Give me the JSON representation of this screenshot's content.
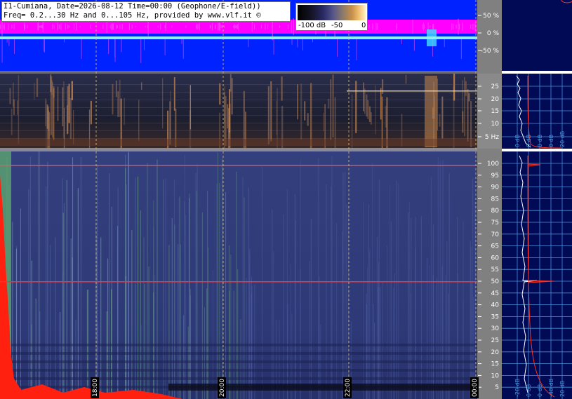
{
  "window": {
    "title_line1": "I1-Cumiana, Date=2026-08-12 Time=00:00 (Geophone/E-field))",
    "title_line2": "Freq= 0.2...30 Hz and 0...105 Hz, provided by www.vlf.it ©"
  },
  "colors": {
    "background": "#ffffff",
    "top_panel_bg": "#0022ff",
    "top_trace": "#ff00ff",
    "side_panel_bg": "#000a55",
    "spectrogram_bg": "#2e3a78",
    "noise_floor": "#ff2010",
    "marker_line": "#ff3030",
    "grid": "#4a8fd8"
  },
  "colorbar": {
    "labels": [
      "-100 dB",
      "-50",
      "0"
    ]
  },
  "top_panel": {
    "y_labels": [
      "50 %",
      "0 %",
      "-50 %"
    ]
  },
  "mid_panel": {
    "y_labels": [
      "25",
      "20",
      "15",
      "10",
      "5 Hz"
    ]
  },
  "bottom_panel": {
    "y_labels": [
      "100",
      "95",
      "90",
      "85",
      "80",
      "75",
      "70",
      "65",
      "60",
      "55",
      "50",
      "45",
      "40",
      "35",
      "30",
      "25",
      "20",
      "15",
      "10",
      "5"
    ]
  },
  "time_axis": {
    "labels": [
      "18:00",
      "20:00",
      "22:00",
      "00:00"
    ]
  },
  "side_mid": {
    "x_labels": [
      "0 dB",
      "0 dB",
      "0 dB",
      "0 dB",
      "20 dB"
    ]
  },
  "side_bottom": {
    "x_labels": [
      "-20 dB",
      "0 dB",
      "0 dB",
      "-40 dB",
      "20 dB"
    ]
  }
}
